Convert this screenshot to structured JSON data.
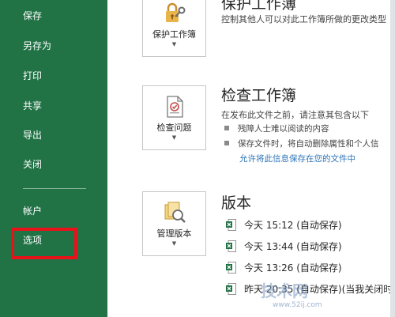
{
  "sidebar": {
    "items": [
      {
        "label": "保存"
      },
      {
        "label": "另存为"
      },
      {
        "label": "打印"
      },
      {
        "label": "共享"
      },
      {
        "label": "导出"
      },
      {
        "label": "关闭"
      },
      {
        "label": "帐户"
      },
      {
        "label": "选项"
      }
    ],
    "highlight_color": "#e8121a",
    "background_color": "#217346"
  },
  "sections": {
    "protect": {
      "title": "保护工作簿",
      "description": "控制其他人可以对此工作簿所做的更改类型",
      "button_label": "保护工作簿",
      "icon": "lock-key-icon"
    },
    "inspect": {
      "title": "检查工作簿",
      "description": "在发布此文件之前，请注意其包含以下",
      "button_label": "检查问题",
      "icon": "inspect-document-icon",
      "bullets": [
        "残障人士难以阅读的内容",
        "保存文件时，将自动删除属性和个人信"
      ],
      "link": "允许将此信息保存在您的文件中"
    },
    "versions": {
      "title": "版本",
      "button_label": "管理版本",
      "icon": "manage-versions-icon",
      "items": [
        {
          "label": "今天 15:12 (自动保存)"
        },
        {
          "label": "今天 13:44 (自动保存)"
        },
        {
          "label": "今天 13:26 (自动保存)"
        },
        {
          "label": "昨天 20:35 (自动保存)(当我关闭时"
        }
      ]
    }
  },
  "watermark": {
    "text": "技术网",
    "url": "www.52ij.com"
  }
}
